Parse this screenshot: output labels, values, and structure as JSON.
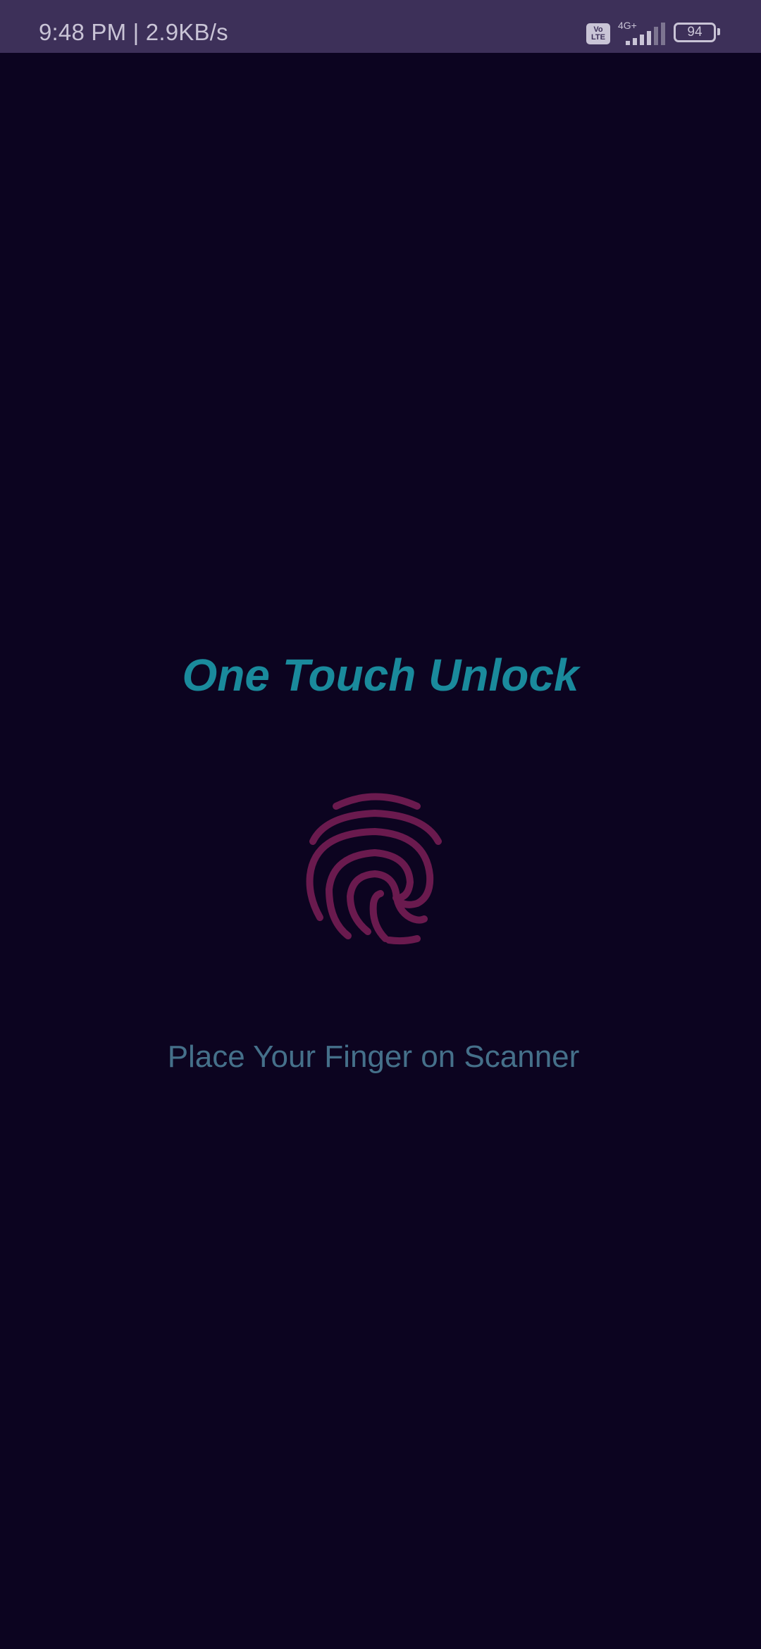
{
  "status_bar": {
    "time_speed": "9:48 PM | 2.9KB/s",
    "volte_label": "Vo LTE",
    "network_label": "4G+",
    "battery_level": "94",
    "icons": [
      "volte-icon",
      "signal-icon",
      "battery-icon"
    ]
  },
  "main": {
    "title": "One Touch Unlock",
    "fingerprint_icon": "fingerprint-icon",
    "prompt": "Place Your Finger on Scanner"
  },
  "colors": {
    "background": "#0c0420",
    "status_bar": "#3d3059",
    "title": "#1a8a9c",
    "fingerprint": "#6a1a4e",
    "prompt": "#45708a"
  }
}
